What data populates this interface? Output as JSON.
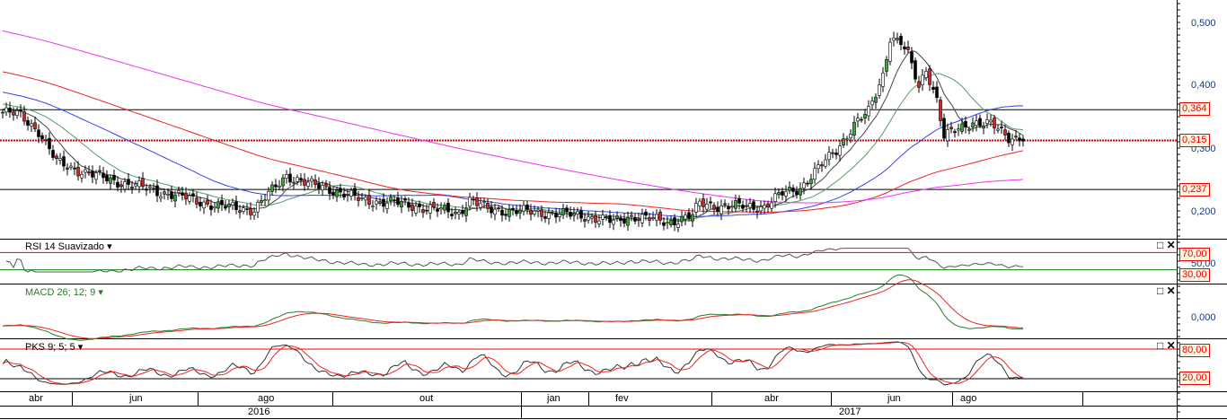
{
  "chart_data": {
    "type": "candlestick",
    "x_unit": "week index",
    "price_points": [
      [
        0,
        0.36
      ],
      [
        5,
        0.355
      ],
      [
        10,
        0.33
      ],
      [
        15,
        0.28
      ],
      [
        25,
        0.26
      ],
      [
        35,
        0.245
      ],
      [
        50,
        0.225
      ],
      [
        60,
        0.21
      ],
      [
        70,
        0.205
      ],
      [
        75,
        0.235
      ],
      [
        79,
        0.26
      ],
      [
        85,
        0.245
      ],
      [
        90,
        0.24
      ],
      [
        100,
        0.22
      ],
      [
        110,
        0.215
      ],
      [
        120,
        0.205
      ],
      [
        127,
        0.2
      ],
      [
        130,
        0.22
      ],
      [
        135,
        0.205
      ],
      [
        150,
        0.2
      ],
      [
        162,
        0.195
      ],
      [
        170,
        0.185
      ],
      [
        175,
        0.195
      ],
      [
        185,
        0.185
      ],
      [
        192,
        0.195
      ],
      [
        194,
        0.215
      ],
      [
        200,
        0.21
      ],
      [
        212,
        0.21
      ],
      [
        217,
        0.23
      ],
      [
        222,
        0.24
      ],
      [
        227,
        0.27
      ],
      [
        232,
        0.3
      ],
      [
        237,
        0.34
      ],
      [
        241,
        0.36
      ],
      [
        245,
        0.42
      ],
      [
        247,
        0.48
      ],
      [
        250,
        0.47
      ],
      [
        252,
        0.45
      ],
      [
        255,
        0.4
      ],
      [
        257,
        0.43
      ],
      [
        260,
        0.38
      ],
      [
        262,
        0.32
      ],
      [
        265,
        0.33
      ],
      [
        270,
        0.345
      ],
      [
        275,
        0.34
      ],
      [
        280,
        0.32
      ],
      [
        284,
        0.32
      ]
    ],
    "moving_averages": [
      {
        "period": 9,
        "color": "#444444"
      },
      {
        "period": 21,
        "color": "#5a9a6a"
      },
      {
        "period": 50,
        "color": "#3344ee"
      },
      {
        "period": 100,
        "color": "#ee2222"
      },
      {
        "period": 200,
        "color": "#ee33ee"
      }
    ],
    "y_ticks": [
      "0,500",
      "0,400",
      "0,300",
      "0,200"
    ],
    "y_tick_values": [
      0.5,
      0.4,
      0.3,
      0.2
    ],
    "h_lines": [
      {
        "value": 0.364,
        "label": "0,364",
        "style": "solid"
      },
      {
        "value": 0.315,
        "label": "0,315",
        "style": "dotted"
      },
      {
        "value": 0.237,
        "label": "0,237",
        "style": "solid"
      }
    ],
    "x_months": [
      "abr",
      "jun",
      "ago",
      "out",
      "jan",
      "fev",
      "abr",
      "jun",
      "ago"
    ],
    "x_years": [
      "2016",
      "2017"
    ],
    "indicators": {
      "rsi": {
        "title": "RSI 14 Suavizado",
        "levels": [
          "70,00",
          "30,00"
        ],
        "mid": "50,00"
      },
      "macd": {
        "title": "MACD 26; 12; 9",
        "tick": "0,000"
      },
      "pks": {
        "title": "PKS 9; 5; 5",
        "levels": [
          "80,00",
          "20,00"
        ]
      }
    }
  },
  "controls": {
    "maximize": "□",
    "close": "✕",
    "dropdown": "▾"
  }
}
